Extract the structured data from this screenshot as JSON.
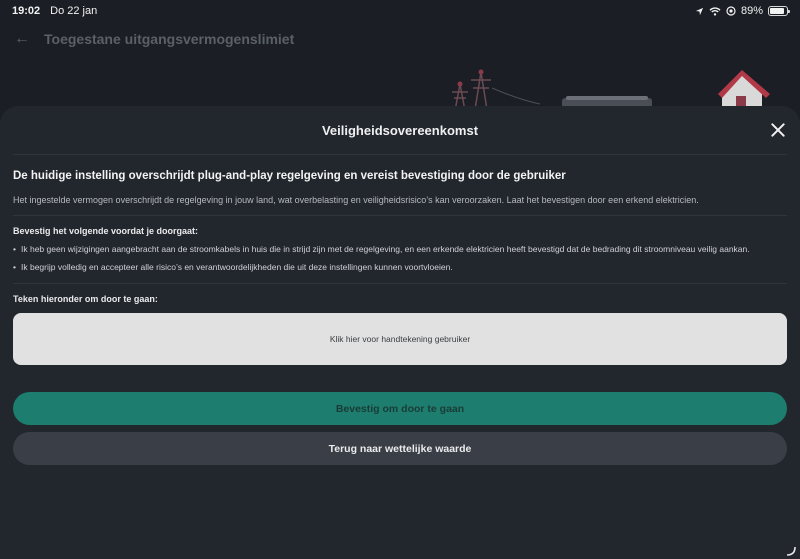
{
  "status_bar": {
    "time": "19:02",
    "date": "Do 22 jan",
    "battery": "89%",
    "battery_level": 0.89,
    "icons": [
      "location-icon",
      "wifi-icon",
      "focus-icon",
      "battery-icon"
    ]
  },
  "background": {
    "title": "Toegestane uitgangsvermogenslimiet"
  },
  "modal": {
    "title": "Veiligheidsovereenkomst",
    "heading": "De huidige instelling overschrijdt plug-and-play regelgeving en vereist bevestiging door de gebruiker",
    "description": "Het ingestelde vermogen overschrijdt de regelgeving in jouw land, wat overbelasting en veiligheidsrisico’s kan veroorzaken. Laat het bevestigen door een erkend elektricien.",
    "confirm_heading": "Bevestig het volgende voordat je doorgaat:",
    "bullets": [
      "Ik heb geen wijzigingen aangebracht aan de stroomkabels in huis die in strijd zijn met de regelgeving, en een erkende elektricien heeft bevestigd dat de bedrading dit stroomniveau veilig aankan.",
      "Ik begrijp volledig en accepteer alle risico’s en verantwoordelijkheden die uit deze instellingen kunnen voortvloeien."
    ],
    "sign_label": "Teken hieronder om door te gaan:",
    "signature_placeholder": "Klik hier voor handtekening gebruiker",
    "confirm_button": "Bevestig om door te gaan",
    "back_button": "Terug naar wettelijke waarde"
  },
  "colors": {
    "background": "#1b1e24",
    "sheet": "#22262d",
    "primary": "#1d7d6f",
    "secondary": "#3a3e46",
    "signature_box": "#e1e1e1"
  }
}
